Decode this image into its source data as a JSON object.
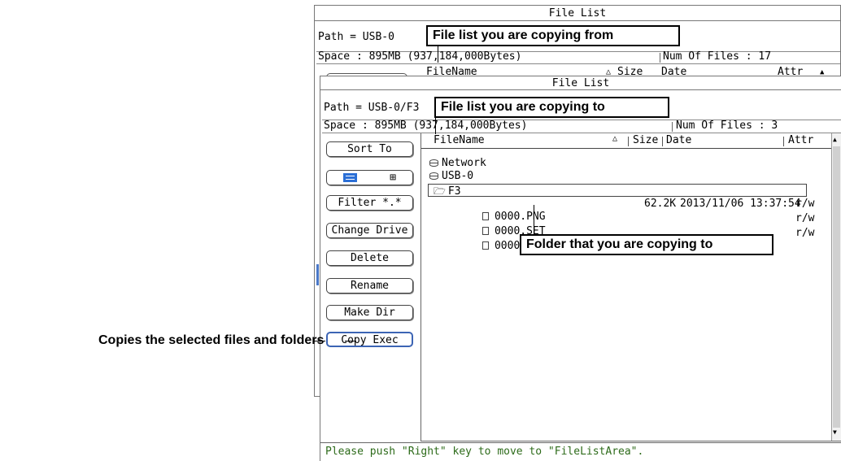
{
  "callouts": {
    "from": "File list you are copying from",
    "to": "File list you are copying to",
    "folder": "Folder that you are copying to",
    "copies": "Copies the selected files and folders"
  },
  "back_window": {
    "title": "File List",
    "path": "Path = USB-0",
    "space": "Space : 895MB (937,184,000Bytes)",
    "num_files": "Num Of Files : 17",
    "headers": {
      "name": "FileName",
      "sort_arrow": "△",
      "size": "Size",
      "date": "Date",
      "attr": "Attr"
    }
  },
  "front_window": {
    "title": "File List",
    "path": "Path = USB-0/F3",
    "space": "Space : 895MB (937,184,000Bytes)",
    "num_files": "Num Of Files : 3",
    "buttons": {
      "sort_to": "Sort To",
      "view_grid": "⊞",
      "filter": "Filter  *.*",
      "change_drive": "Change Drive",
      "delete": "Delete",
      "rename": "Rename",
      "make_dir": "Make Dir",
      "copy_exec": "Copy Exec"
    },
    "headers": {
      "name": "FileName",
      "sort_arrow": "△",
      "size": "Size",
      "date": "Date",
      "attr": "Attr"
    },
    "tree": {
      "network": "Network",
      "usb": "USB-0",
      "folder": "F3"
    },
    "files": [
      {
        "name": "0000.PNG",
        "size": "62.2K",
        "date": "2013/11/06 13:37:54",
        "attr": "r/w"
      },
      {
        "name": "0000.SET",
        "size": "",
        "date": "",
        "attr": "r/w"
      },
      {
        "name": "0000.WPF",
        "size": "",
        "date": "",
        "attr": "r/w"
      }
    ],
    "status": "Please push \"Right\" key to move to \"FileListArea\"."
  },
  "colors": {
    "status_text": "#2d6b1a",
    "selected_border": "#3c64b4",
    "view_icon": "#2b6fd6"
  }
}
